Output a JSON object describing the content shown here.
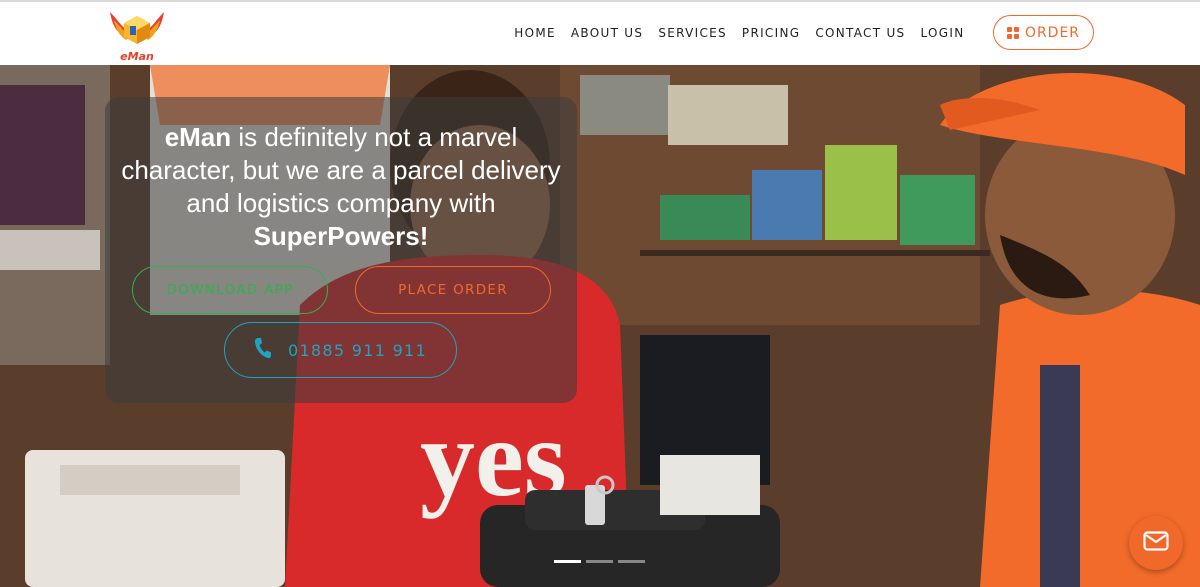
{
  "brand": {
    "logo_text": "eMan"
  },
  "nav": {
    "items": [
      {
        "label": "HOME"
      },
      {
        "label": "ABOUT US"
      },
      {
        "label": "SERVICES"
      },
      {
        "label": "PRICING"
      },
      {
        "label": "CONTACT US"
      },
      {
        "label": "LOGIN"
      }
    ],
    "order_label": "ORDER"
  },
  "hero": {
    "headline_bold_1": "eMan",
    "headline_mid": " is definitely not a marvel character, but we are a parcel delivery and logistics company with ",
    "headline_bold_2": "SuperPowers!",
    "download_label": "DOWNLOAD APP",
    "place_order_label": "PLACE ORDER",
    "phone": "01885 911 911",
    "slides": {
      "count": 3,
      "active": 1
    }
  },
  "colors": {
    "accent_orange": "#f0692b",
    "accent_green": "#2fb24a",
    "accent_teal": "#1fa3bf"
  },
  "icons": {
    "order": "grid-icon",
    "phone": "phone-icon",
    "mail": "mail-icon"
  }
}
